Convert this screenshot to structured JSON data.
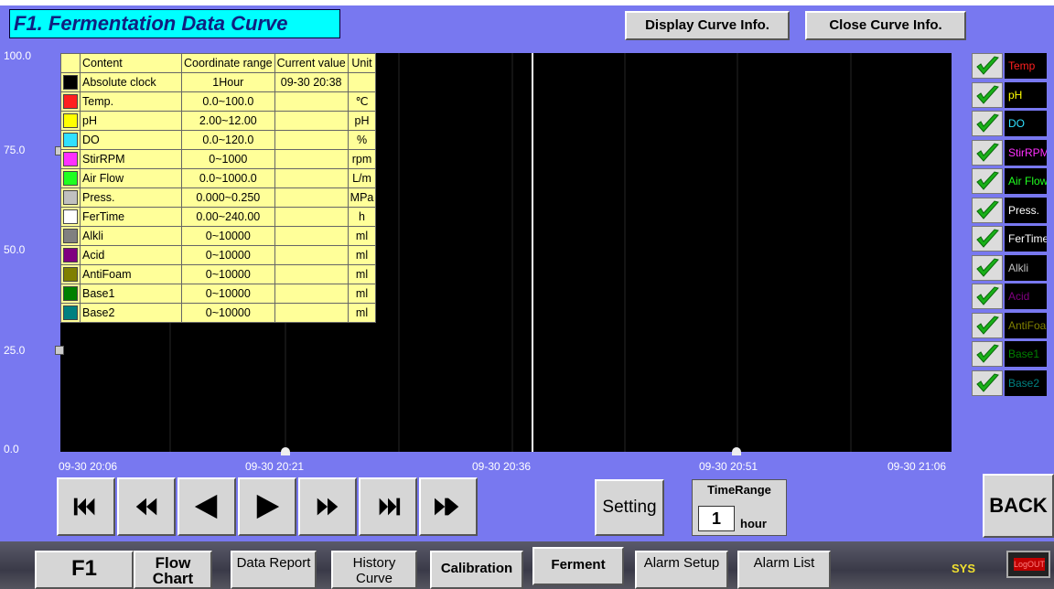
{
  "title": "F1. Fermentation Data Curve",
  "buttons": {
    "display_info": "Display Curve Info.",
    "close_info": "Close Curve Info."
  },
  "y_axis": [
    "100.0",
    "75.0",
    "50.0",
    "25.0",
    "0.0"
  ],
  "x_axis": [
    "09-30 20:06",
    "09-30 20:21",
    "09-30 20:36",
    "09-30 20:51",
    "09-30 21:06"
  ],
  "table": {
    "headers": [
      "Content",
      "Coordinate range",
      "Current value",
      "Unit"
    ],
    "rows": [
      {
        "swatch": "#000000",
        "content": "Absolute clock",
        "range": "1Hour",
        "current": "09-30 20:38",
        "unit": ""
      },
      {
        "swatch": "#ff2020",
        "content": "Temp.",
        "range": "0.0~100.0",
        "current": "",
        "unit": "℃"
      },
      {
        "swatch": "#ffff00",
        "content": "pH",
        "range": "2.00~12.00",
        "current": "",
        "unit": "pH"
      },
      {
        "swatch": "#30e0ff",
        "content": "DO",
        "range": "0.0~120.0",
        "current": "",
        "unit": "%"
      },
      {
        "swatch": "#ff30ff",
        "content": "StirRPM",
        "range": "0~1000",
        "current": "",
        "unit": "rpm"
      },
      {
        "swatch": "#20ff20",
        "content": "Air Flow",
        "range": "0.0~1000.0",
        "current": "",
        "unit": "L/m"
      },
      {
        "swatch": "#c0c0c0",
        "content": "Press.",
        "range": "0.000~0.250",
        "current": "",
        "unit": "MPa"
      },
      {
        "swatch": "#ffffff",
        "content": "FerTime",
        "range": "0.00~240.00",
        "current": "",
        "unit": "h"
      },
      {
        "swatch": "#808080",
        "content": "Alkli",
        "range": "0~10000",
        "current": "",
        "unit": "ml"
      },
      {
        "swatch": "#800080",
        "content": "Acid",
        "range": "0~10000",
        "current": "",
        "unit": "ml"
      },
      {
        "swatch": "#808000",
        "content": "AntiFoam",
        "range": "0~10000",
        "current": "",
        "unit": "ml"
      },
      {
        "swatch": "#008000",
        "content": "Base1",
        "range": "0~10000",
        "current": "",
        "unit": "ml"
      },
      {
        "swatch": "#008080",
        "content": "Base2",
        "range": "0~10000",
        "current": "",
        "unit": "ml"
      }
    ]
  },
  "legend": [
    {
      "label": "Temp",
      "color": "#ff2020"
    },
    {
      "label": "pH",
      "color": "#ffff00"
    },
    {
      "label": "DO",
      "color": "#30e0ff"
    },
    {
      "label": "StirRPM",
      "color": "#ff30ff"
    },
    {
      "label": "Air Flow",
      "color": "#20ff20"
    },
    {
      "label": "Press.",
      "color": "#ffffff"
    },
    {
      "label": "FerTime",
      "color": "#ffffff"
    },
    {
      "label": "Alkli",
      "color": "#c0c0c0"
    },
    {
      "label": "Acid",
      "color": "#800080"
    },
    {
      "label": "AntiFoam",
      "color": "#808000"
    },
    {
      "label": "Base1",
      "color": "#008000"
    },
    {
      "label": "Base2",
      "color": "#008080"
    }
  ],
  "nav_icons": [
    "first-icon",
    "fast-backward-icon",
    "step-backward-icon",
    "step-forward-icon",
    "fast-forward-icon",
    "last-icon",
    "fit-icon"
  ],
  "setting_label": "Setting",
  "time_range": {
    "label": "TimeRange",
    "value": "1",
    "unit": "hour"
  },
  "back_label": "BACK",
  "tabs": [
    {
      "label": "F1"
    },
    {
      "label": "Flow Chart"
    },
    {
      "label": "Data Report"
    },
    {
      "label": "History Curve"
    },
    {
      "label": "Calibration"
    },
    {
      "label": "Ferment"
    },
    {
      "label": "Alarm Setup"
    },
    {
      "label": "Alarm List"
    }
  ],
  "sys_label": "SYS",
  "logout_label": "LogOUT"
}
